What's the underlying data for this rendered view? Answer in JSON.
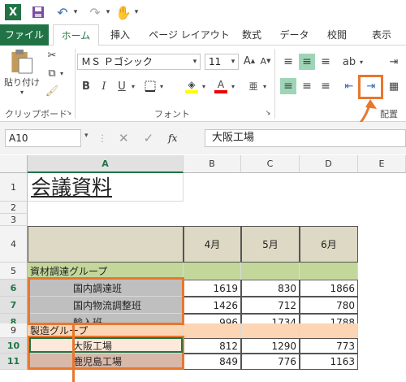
{
  "titlebar": {
    "app_icon": "X"
  },
  "tabs": [
    "ファイル",
    "ホーム",
    "挿入",
    "ページ レイアウト",
    "数式",
    "データ",
    "校閲",
    "表示"
  ],
  "ribbon": {
    "clipboard": {
      "paste_label": "貼り付け",
      "group_label": "クリップボード"
    },
    "font": {
      "font_name": "ＭＳ Ｐゴシック",
      "font_size": "11",
      "group_label": "フォント"
    },
    "alignment": {
      "group_label": "配置"
    }
  },
  "formula_bar": {
    "name_box": "A10",
    "fx": "fx",
    "value": "大阪工場"
  },
  "columns": [
    "A",
    "B",
    "C",
    "D",
    "E"
  ],
  "rows": [
    "1",
    "2",
    "3",
    "4",
    "5",
    "6",
    "7",
    "8",
    "9",
    "10",
    "11"
  ],
  "sheet": {
    "title": "会議資料",
    "month_headers": [
      "4月",
      "5月",
      "6月"
    ],
    "group1": "資材調達グループ",
    "items1": [
      {
        "name": "国内調達班",
        "vals": [
          "1619",
          "830",
          "1866"
        ]
      },
      {
        "name": "国内物流調整班",
        "vals": [
          "1426",
          "712",
          "780"
        ]
      },
      {
        "name": "輸入班",
        "vals": [
          "996",
          "1734",
          "1788"
        ]
      }
    ],
    "group2": "製造グループ",
    "items2": [
      {
        "name": "大阪工場",
        "vals": [
          "812",
          "1290",
          "773"
        ]
      },
      {
        "name": "鹿児島工場",
        "vals": [
          "849",
          "776",
          "1163"
        ]
      }
    ]
  },
  "colors": {
    "excel_green": "#217346",
    "tan": "#ddd9c4",
    "olive": "#c4d79b",
    "gray": "#bfbfbf",
    "peach": "#fcd5b4",
    "orange": "#f79646",
    "annotation": "#e8772e"
  }
}
